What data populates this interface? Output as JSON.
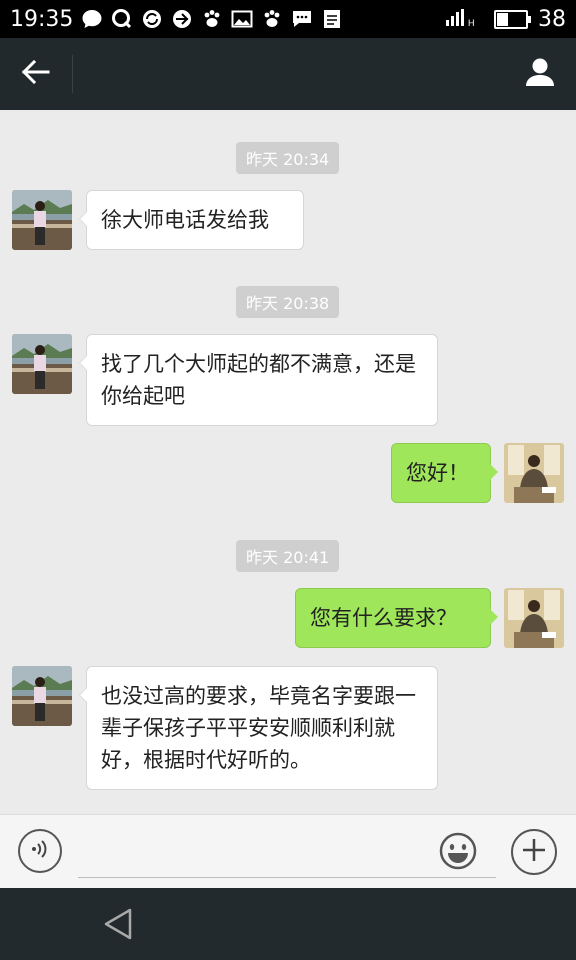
{
  "status_bar": {
    "time": "19:35",
    "battery_text": "38",
    "battery_level": 0.38,
    "icons": [
      "message-icon",
      "qq-icon",
      "sync-icon",
      "app-icon",
      "paw-icon",
      "gallery-icon",
      "paw-icon",
      "sms-icon",
      "document-icon",
      "signal-icon",
      "battery-icon"
    ]
  },
  "header": {
    "title": "",
    "back_icon": "arrow-left-icon",
    "profile_icon": "person-icon"
  },
  "messages": [
    {
      "type": "time",
      "text": "昨天 20:34"
    },
    {
      "type": "in",
      "text": "徐大师电话发给我"
    },
    {
      "type": "time",
      "text": "昨天 20:38"
    },
    {
      "type": "in",
      "text": "找了几个大师起的都不满意，还是你给起吧"
    },
    {
      "type": "out",
      "text": "您好！"
    },
    {
      "type": "time",
      "text": "昨天 20:41"
    },
    {
      "type": "out",
      "text": "您有什么要求？"
    },
    {
      "type": "in",
      "text": "也没过高的要求，毕竟名字要跟一辈子保孩子平平安安顺顺利利就好，根据时代好听的。"
    }
  ],
  "input_bar": {
    "placeholder": "",
    "value": "",
    "voice_icon": "voice-icon",
    "emoji_icon": "emoji-icon",
    "plus_icon": "plus-icon"
  },
  "nav_bar": {
    "back_icon": "nav-back-icon"
  },
  "colors": {
    "outgoing_bubble": "#a0e65a",
    "incoming_bubble": "#ffffff",
    "header_bg": "#22292c",
    "chat_bg": "#ebebeb"
  }
}
